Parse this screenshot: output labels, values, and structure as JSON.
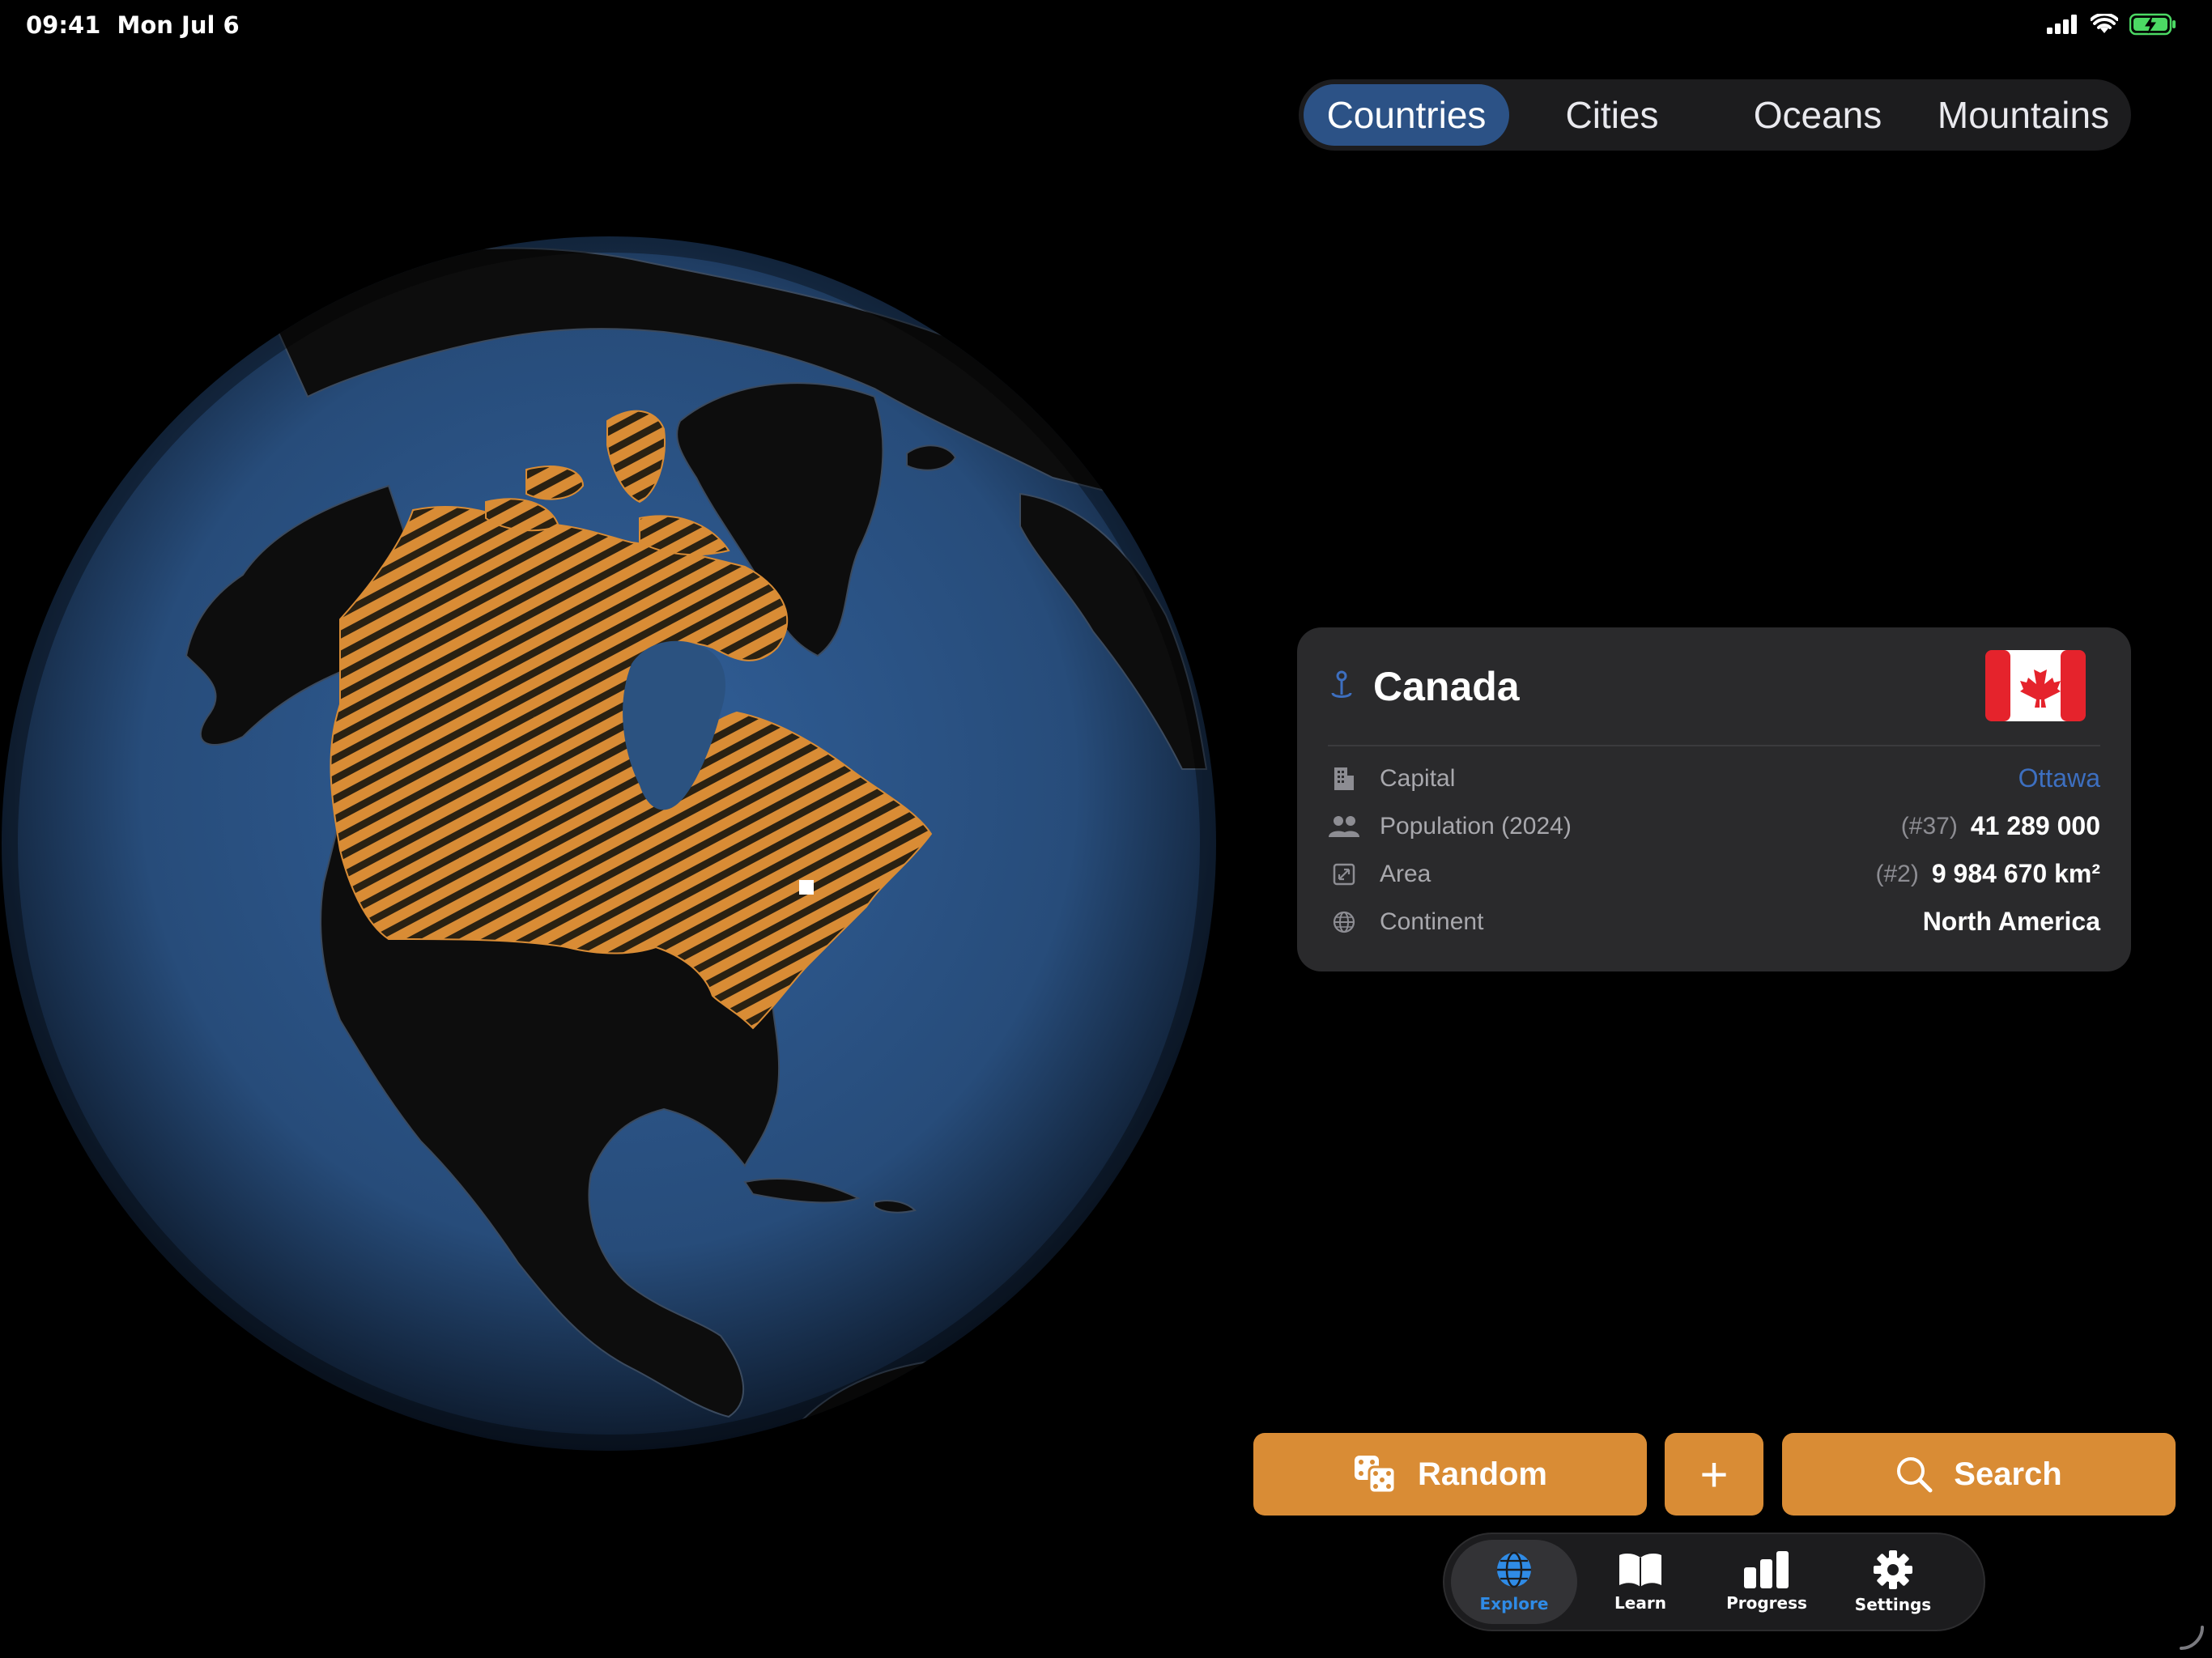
{
  "status": {
    "time": "09:41",
    "date": "Mon Jul 6"
  },
  "segments": [
    {
      "label": "Countries",
      "active": true
    },
    {
      "label": "Cities",
      "active": false
    },
    {
      "label": "Oceans",
      "active": false
    },
    {
      "label": "Mountains",
      "active": false
    }
  ],
  "globe": {
    "ocean_color": "#2b5280",
    "land_color": "#0d0d0d",
    "highlight_color": "#d98c35"
  },
  "country": {
    "name": "Canada",
    "rows": [
      {
        "icon": "building-icon",
        "label": "Capital",
        "rank": "",
        "value": "Ottawa"
      },
      {
        "icon": "people-icon",
        "label": "Population (2024)",
        "rank": "(#37)",
        "value": "41 289 000"
      },
      {
        "icon": "area-icon",
        "label": "Area",
        "rank": "(#2)",
        "value": "9 984 670 km²"
      },
      {
        "icon": "globe-icon",
        "label": "Continent",
        "rank": "",
        "value": "North America"
      }
    ]
  },
  "actions": {
    "random": "Random",
    "add": "+",
    "search": "Search"
  },
  "tabs": [
    {
      "label": "Explore",
      "icon": "globe-icon",
      "active": true
    },
    {
      "label": "Learn",
      "icon": "book-icon",
      "active": false
    },
    {
      "label": "Progress",
      "icon": "bar-chart-icon",
      "active": false
    },
    {
      "label": "Settings",
      "icon": "gear-icon",
      "active": false
    }
  ],
  "colors": {
    "accent": "#d98c35",
    "segment_active": "#2c5286",
    "link": "#3d6fc0",
    "tab_active": "#2f8be6"
  }
}
